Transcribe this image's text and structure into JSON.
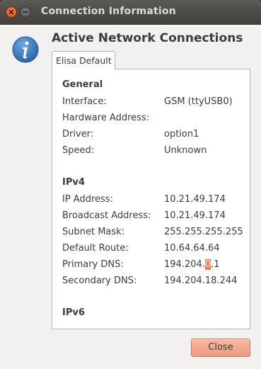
{
  "window": {
    "title": "Connection Information"
  },
  "dialog": {
    "heading": "Active Network Connections",
    "tab_label": "Elisa Default",
    "close_label": "Close"
  },
  "general": {
    "title": "General",
    "rows": [
      {
        "label": "Interface:",
        "value": "GSM (ttyUSB0)"
      },
      {
        "label": "Hardware Address:",
        "value": ""
      },
      {
        "label": "Driver:",
        "value": "option1"
      },
      {
        "label": "Speed:",
        "value": "Unknown"
      }
    ]
  },
  "ipv4": {
    "title": "IPv4",
    "rows": [
      {
        "label": "IP Address:",
        "value": "10.21.49.174"
      },
      {
        "label": "Broadcast Address:",
        "value": "10.21.49.174"
      },
      {
        "label": "Subnet Mask:",
        "value": "255.255.255.255"
      },
      {
        "label": "Default Route:",
        "value": "10.64.64.64"
      },
      {
        "label": "Primary DNS:",
        "value_before": "194.204.",
        "value_selected": "0",
        "value_after": ".1"
      },
      {
        "label": "Secondary DNS:",
        "value": "194.204.18.244"
      }
    ]
  },
  "ipv6": {
    "title": "IPv6"
  },
  "colors": {
    "accent": "#f49a7a",
    "selection": "#f07746",
    "info_icon": "#3f7fc1"
  }
}
